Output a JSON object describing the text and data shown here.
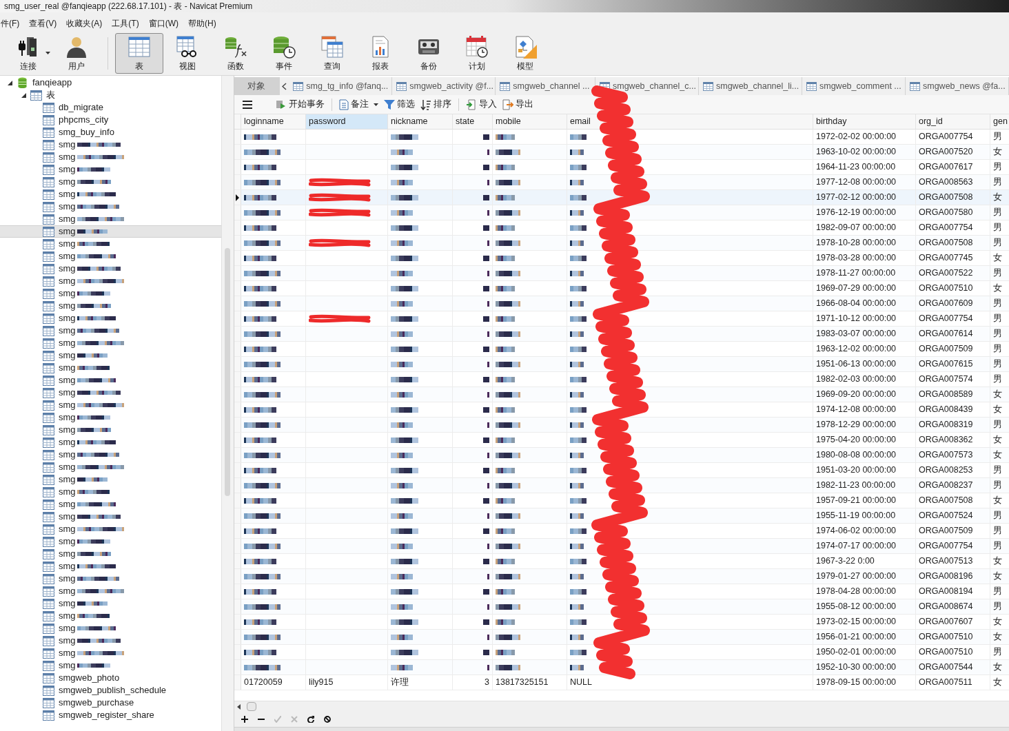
{
  "window": {
    "title": "smg_user_real @fanqieapp (222.68.17.101) - 表 - Navicat Premium"
  },
  "menu": [
    "件(F)",
    "查看(V)",
    "收藏夹(A)",
    "工具(T)",
    "窗口(W)",
    "帮助(H)"
  ],
  "toolbar": [
    {
      "label": "连接",
      "selected": false,
      "dropdown": true
    },
    {
      "label": "用户",
      "selected": false,
      "dropdown": false
    },
    {
      "label": "表",
      "selected": true,
      "dropdown": false
    },
    {
      "label": "视图",
      "selected": false,
      "dropdown": false
    },
    {
      "label": "函数",
      "selected": false,
      "dropdown": false
    },
    {
      "label": "事件",
      "selected": false,
      "dropdown": false
    },
    {
      "label": "查询",
      "selected": false,
      "dropdown": false
    },
    {
      "label": "报表",
      "selected": false,
      "dropdown": false
    },
    {
      "label": "备份",
      "selected": false,
      "dropdown": false
    },
    {
      "label": "计划",
      "selected": false,
      "dropdown": false
    },
    {
      "label": "模型",
      "selected": false,
      "dropdown": false
    }
  ],
  "sidebar": {
    "tree": [
      {
        "label": "fanqieapp",
        "expanded": true,
        "children": [
          {
            "label": "表",
            "expanded": true,
            "children": [
              {
                "label": "db_migrate",
                "pixelated": false,
                "selected": false
              },
              {
                "label": "phpcms_city",
                "pixelated": false,
                "selected": false
              },
              {
                "label": "smg_buy_info",
                "pixelated": false,
                "selected": false
              },
              {
                "label": "smg",
                "pixelated": true,
                "selected": false
              },
              {
                "label": "smg",
                "pixelated": true,
                "selected": false
              },
              {
                "label": "smg",
                "pixelated": true,
                "selected": false
              },
              {
                "label": "smg",
                "pixelated": true,
                "selected": false
              },
              {
                "label": "smg",
                "pixelated": true,
                "selected": false
              },
              {
                "label": "smg",
                "pixelated": true,
                "selected": false
              },
              {
                "label": "smg",
                "pixelated": true,
                "selected": false
              },
              {
                "label": "smg",
                "pixelated": true,
                "selected": true
              },
              {
                "label": "smg",
                "pixelated": true,
                "selected": false
              },
              {
                "label": "smg",
                "pixelated": true,
                "selected": false
              },
              {
                "label": "smg",
                "pixelated": true,
                "selected": false
              },
              {
                "label": "smg",
                "pixelated": true,
                "selected": false
              },
              {
                "label": "smg",
                "pixelated": true,
                "selected": false
              },
              {
                "label": "smg",
                "pixelated": true,
                "selected": false
              },
              {
                "label": "smg",
                "pixelated": true,
                "selected": false
              },
              {
                "label": "smg",
                "pixelated": true,
                "selected": false
              },
              {
                "label": "smg",
                "pixelated": true,
                "selected": false
              },
              {
                "label": "smg",
                "pixelated": true,
                "selected": false
              },
              {
                "label": "smg",
                "pixelated": true,
                "selected": false
              },
              {
                "label": "smg",
                "pixelated": true,
                "selected": false
              },
              {
                "label": "smg",
                "pixelated": true,
                "selected": false
              },
              {
                "label": "smg",
                "pixelated": true,
                "selected": false
              },
              {
                "label": "smg",
                "pixelated": true,
                "selected": false
              },
              {
                "label": "smg",
                "pixelated": true,
                "selected": false
              },
              {
                "label": "smg",
                "pixelated": true,
                "selected": false
              },
              {
                "label": "smg",
                "pixelated": true,
                "selected": false
              },
              {
                "label": "smg",
                "pixelated": true,
                "selected": false
              },
              {
                "label": "smg",
                "pixelated": true,
                "selected": false
              },
              {
                "label": "smg",
                "pixelated": true,
                "selected": false
              },
              {
                "label": "smg",
                "pixelated": true,
                "selected": false
              },
              {
                "label": "smg",
                "pixelated": true,
                "selected": false
              },
              {
                "label": "smg",
                "pixelated": true,
                "selected": false
              },
              {
                "label": "smg",
                "pixelated": true,
                "selected": false
              },
              {
                "label": "smg",
                "pixelated": true,
                "selected": false
              },
              {
                "label": "smg",
                "pixelated": true,
                "selected": false
              },
              {
                "label": "smg",
                "pixelated": true,
                "selected": false
              },
              {
                "label": "smg",
                "pixelated": true,
                "selected": false
              },
              {
                "label": "smg",
                "pixelated": true,
                "selected": false
              },
              {
                "label": "smg",
                "pixelated": true,
                "selected": false
              },
              {
                "label": "smg",
                "pixelated": true,
                "selected": false
              },
              {
                "label": "smg",
                "pixelated": true,
                "selected": false
              },
              {
                "label": "smg",
                "pixelated": true,
                "selected": false
              },
              {
                "label": "smg",
                "pixelated": true,
                "selected": false
              },
              {
                "label": "smgweb_photo",
                "pixelated": false,
                "selected": false
              },
              {
                "label": "smgweb_publish_schedule",
                "pixelated": false,
                "selected": false
              },
              {
                "label": "smgweb_purchase",
                "pixelated": false,
                "selected": false
              },
              {
                "label": "smgweb_register_share",
                "pixelated": false,
                "selected": false
              }
            ]
          }
        ]
      }
    ]
  },
  "tabs": [
    {
      "label": "对象",
      "selected": false,
      "kind": "objects"
    },
    {
      "label": "smg_tg_info @fanq...",
      "selected": false,
      "kind": "table"
    },
    {
      "label": "smgweb_activity @f...",
      "selected": false,
      "kind": "table"
    },
    {
      "label": "smgweb_channel ...",
      "selected": false,
      "kind": "table"
    },
    {
      "label": "smgweb_channel_c...",
      "selected": false,
      "kind": "table"
    },
    {
      "label": "smgweb_channel_li...",
      "selected": false,
      "kind": "table"
    },
    {
      "label": "smgweb_comment ...",
      "selected": false,
      "kind": "table"
    },
    {
      "label": "smgweb_news @fa...",
      "selected": false,
      "kind": "table"
    }
  ],
  "actions": [
    {
      "label": "开始事务",
      "dropdown": false
    },
    {
      "label": "备注",
      "dropdown": true
    },
    {
      "label": "筛选",
      "dropdown": false
    },
    {
      "label": "排序",
      "dropdown": false
    },
    {
      "label": "导入",
      "dropdown": false
    },
    {
      "label": "导出",
      "dropdown": false
    }
  ],
  "table": {
    "columns": [
      {
        "label": "loginname",
        "selected": false
      },
      {
        "label": "password",
        "selected": true
      },
      {
        "label": "nickname",
        "selected": false
      },
      {
        "label": "state",
        "selected": false
      },
      {
        "label": "mobile",
        "selected": false
      },
      {
        "label": "email",
        "selected": false
      },
      {
        "label": "birthday",
        "selected": false
      },
      {
        "label": "org_id",
        "selected": false
      },
      {
        "label": "gen",
        "selected": false
      }
    ],
    "rows": [
      {
        "pixelated": true,
        "password_scribbled": false,
        "selected": false,
        "birthday": "1972-02-02 00:00:00",
        "org_id": "ORGA007754",
        "gender": "男"
      },
      {
        "pixelated": true,
        "password_scribbled": false,
        "selected": false,
        "birthday": "1963-10-02 00:00:00",
        "org_id": "ORGA007520",
        "gender": "女"
      },
      {
        "pixelated": true,
        "password_scribbled": false,
        "selected": false,
        "birthday": "1964-11-23 00:00:00",
        "org_id": "ORGA007617",
        "gender": "男"
      },
      {
        "pixelated": true,
        "password_scribbled": true,
        "selected": false,
        "birthday": "1977-12-08 00:00:00",
        "org_id": "ORGA008563",
        "gender": "男"
      },
      {
        "pixelated": true,
        "password_scribbled": true,
        "selected": true,
        "birthday": "1977-02-12 00:00:00",
        "org_id": "ORGA007508",
        "gender": "女"
      },
      {
        "pixelated": true,
        "password_scribbled": true,
        "selected": false,
        "birthday": "1976-12-19 00:00:00",
        "org_id": "ORGA007580",
        "gender": "男"
      },
      {
        "pixelated": true,
        "password_scribbled": false,
        "selected": false,
        "birthday": "1982-09-07 00:00:00",
        "org_id": "ORGA007754",
        "gender": "男"
      },
      {
        "pixelated": true,
        "password_scribbled": true,
        "selected": false,
        "birthday": "1978-10-28 00:00:00",
        "org_id": "ORGA007508",
        "gender": "男"
      },
      {
        "pixelated": true,
        "password_scribbled": false,
        "selected": false,
        "birthday": "1978-03-28 00:00:00",
        "org_id": "ORGA007745",
        "gender": "女"
      },
      {
        "pixelated": true,
        "password_scribbled": false,
        "selected": false,
        "birthday": "1978-11-27 00:00:00",
        "org_id": "ORGA007522",
        "gender": "男"
      },
      {
        "pixelated": true,
        "password_scribbled": false,
        "selected": false,
        "birthday": "1969-07-29 00:00:00",
        "org_id": "ORGA007510",
        "gender": "女"
      },
      {
        "pixelated": true,
        "password_scribbled": false,
        "selected": false,
        "birthday": "1966-08-04 00:00:00",
        "org_id": "ORGA007609",
        "gender": "男"
      },
      {
        "pixelated": true,
        "password_scribbled": true,
        "selected": false,
        "birthday": "1971-10-12 00:00:00",
        "org_id": "ORGA007754",
        "gender": "男"
      },
      {
        "pixelated": true,
        "password_scribbled": false,
        "selected": false,
        "birthday": "1983-03-07 00:00:00",
        "org_id": "ORGA007614",
        "gender": "男"
      },
      {
        "pixelated": true,
        "password_scribbled": false,
        "selected": false,
        "birthday": "1963-12-02 00:00:00",
        "org_id": "ORGA007509",
        "gender": "男"
      },
      {
        "pixelated": true,
        "password_scribbled": false,
        "selected": false,
        "birthday": "1951-06-13 00:00:00",
        "org_id": "ORGA007615",
        "gender": "男"
      },
      {
        "pixelated": true,
        "password_scribbled": false,
        "selected": false,
        "birthday": "1982-02-03 00:00:00",
        "org_id": "ORGA007574",
        "gender": "男"
      },
      {
        "pixelated": true,
        "password_scribbled": false,
        "selected": false,
        "birthday": "1969-09-20 00:00:00",
        "org_id": "ORGA008589",
        "gender": "女"
      },
      {
        "pixelated": true,
        "password_scribbled": false,
        "selected": false,
        "birthday": "1974-12-08 00:00:00",
        "org_id": "ORGA008439",
        "gender": "女"
      },
      {
        "pixelated": true,
        "password_scribbled": false,
        "selected": false,
        "birthday": "1978-12-29 00:00:00",
        "org_id": "ORGA008319",
        "gender": "男"
      },
      {
        "pixelated": true,
        "password_scribbled": false,
        "selected": false,
        "birthday": "1975-04-20 00:00:00",
        "org_id": "ORGA008362",
        "gender": "女"
      },
      {
        "pixelated": true,
        "password_scribbled": false,
        "selected": false,
        "birthday": "1980-08-08 00:00:00",
        "org_id": "ORGA007573",
        "gender": "女"
      },
      {
        "pixelated": true,
        "password_scribbled": false,
        "selected": false,
        "birthday": "1951-03-20 00:00:00",
        "org_id": "ORGA008253",
        "gender": "男"
      },
      {
        "pixelated": true,
        "password_scribbled": false,
        "selected": false,
        "birthday": "1982-11-23 00:00:00",
        "org_id": "ORGA008237",
        "gender": "男"
      },
      {
        "pixelated": true,
        "password_scribbled": false,
        "selected": false,
        "birthday": "1957-09-21 00:00:00",
        "org_id": "ORGA007508",
        "gender": "女"
      },
      {
        "pixelated": true,
        "password_scribbled": false,
        "selected": false,
        "birthday": "1955-11-19 00:00:00",
        "org_id": "ORGA007524",
        "gender": "男"
      },
      {
        "pixelated": true,
        "password_scribbled": false,
        "selected": false,
        "birthday": "1974-06-02 00:00:00",
        "org_id": "ORGA007509",
        "gender": "男"
      },
      {
        "pixelated": true,
        "password_scribbled": false,
        "selected": false,
        "birthday": "1974-07-17 00:00:00",
        "org_id": "ORGA007754",
        "gender": "男"
      },
      {
        "pixelated": true,
        "password_scribbled": false,
        "selected": false,
        "birthday": "1967-3-22 0:00",
        "org_id": "ORGA007513",
        "gender": "女"
      },
      {
        "pixelated": true,
        "password_scribbled": false,
        "selected": false,
        "birthday": "1979-01-27 00:00:00",
        "org_id": "ORGA008196",
        "gender": "女"
      },
      {
        "pixelated": true,
        "password_scribbled": false,
        "selected": false,
        "birthday": "1978-04-28 00:00:00",
        "org_id": "ORGA008194",
        "gender": "男"
      },
      {
        "pixelated": true,
        "password_scribbled": false,
        "selected": false,
        "birthday": "1955-08-12 00:00:00",
        "org_id": "ORGA008674",
        "gender": "男"
      },
      {
        "pixelated": true,
        "password_scribbled": false,
        "selected": false,
        "birthday": "1973-02-15 00:00:00",
        "org_id": "ORGA007607",
        "gender": "女"
      },
      {
        "pixelated": true,
        "password_scribbled": false,
        "selected": false,
        "birthday": "1956-01-21 00:00:00",
        "org_id": "ORGA007510",
        "gender": "女"
      },
      {
        "pixelated": true,
        "password_scribbled": false,
        "selected": false,
        "birthday": "1950-02-01 00:00:00",
        "org_id": "ORGA007510",
        "gender": "男"
      },
      {
        "pixelated": true,
        "password_scribbled": false,
        "selected": false,
        "birthday": "1952-10-30 00:00:00",
        "org_id": "ORGA007544",
        "gender": "女"
      },
      {
        "pixelated": false,
        "password_scribbled": false,
        "selected": false,
        "loginname": "01720059",
        "password": "lily915",
        "nickname": "许理",
        "state": "3",
        "mobile": "13817325151",
        "email": "NULL",
        "birthday": "1978-09-15 00:00:00",
        "org_id": "ORGA007511",
        "gender": "女"
      }
    ]
  },
  "redaction_scribble": true
}
